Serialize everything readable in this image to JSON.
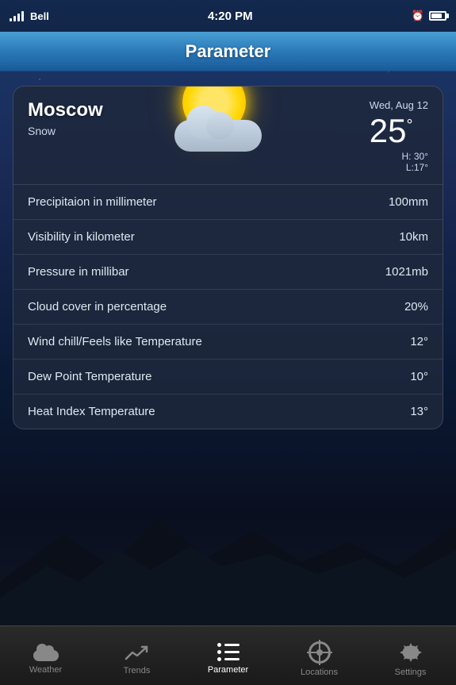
{
  "statusBar": {
    "carrier": "Bell",
    "time": "4:20 PM",
    "clockIcon": "⏰",
    "batteryLevel": "80"
  },
  "header": {
    "title": "Parameter"
  },
  "weatherCard": {
    "city": "Moscow",
    "condition": "Snow",
    "date": "Wed, Aug 12",
    "temperature": "25",
    "tempUnit": "°",
    "high": "H: 30°",
    "low": "L:17°"
  },
  "parameters": [
    {
      "label": "Precipitaion in millimeter",
      "value": "100mm"
    },
    {
      "label": "Visibility in kilometer",
      "value": "10km"
    },
    {
      "label": "Pressure in millibar",
      "value": "1021mb"
    },
    {
      "label": "Cloud cover in percentage",
      "value": "20%"
    },
    {
      "label": "Wind chill/Feels like Temperature",
      "value": "12°"
    },
    {
      "label": "Dew Point Temperature",
      "value": "10°"
    },
    {
      "label": "Heat Index Temperature",
      "value": "13°"
    }
  ],
  "tabBar": {
    "tabs": [
      {
        "id": "weather",
        "label": "Weather",
        "active": false
      },
      {
        "id": "trends",
        "label": "Trends",
        "active": false
      },
      {
        "id": "parameter",
        "label": "Parameter",
        "active": true
      },
      {
        "id": "locations",
        "label": "Locations",
        "active": false
      },
      {
        "id": "settings",
        "label": "Settings",
        "active": false
      }
    ]
  }
}
